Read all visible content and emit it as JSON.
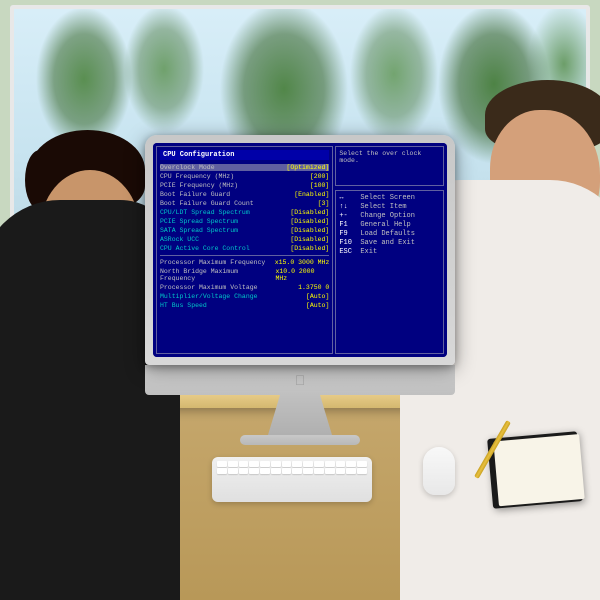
{
  "scene": {
    "alt": "Two people looking at an iMac displaying BIOS CPU Configuration screen"
  },
  "bios": {
    "title": "CPU Configuration",
    "help_title": "Select the over clock mode.",
    "rows": [
      {
        "label": "Overclock Mode",
        "value": "[Optimized]",
        "highlighted": true
      },
      {
        "label": "CPU Frequency (MHz)",
        "value": "[200]"
      },
      {
        "label": "PCIE Frequency (MHz)",
        "value": "[100]"
      },
      {
        "label": "Boot Failure Guard",
        "value": "[Enabled]"
      },
      {
        "label": "Boot Failure Guard Count",
        "value": "[3]"
      },
      {
        "label": "CPU/LDT Spread Spectrum",
        "value": "[Disabled]"
      },
      {
        "label": "PCIE Spread Spectrum",
        "value": "[Disabled]"
      },
      {
        "label": "SATA Spread Spectrum",
        "value": "[Disabled]"
      },
      {
        "label": "ASRock UCC",
        "value": "[Disabled]"
      },
      {
        "label": "CPU Active Core Control",
        "value": "[Disabled]"
      }
    ],
    "divider": true,
    "lower_rows": [
      {
        "label": "Processor Maximum Frequency",
        "value": "x15.0 3000 MHz"
      },
      {
        "label": "North Bridge Maximum Frequency",
        "value": "x10.0 2000 MHz"
      },
      {
        "label": "Processor Maximum Voltage",
        "value": "1.3750 0"
      },
      {
        "label": "Multiplier/Voltage Change",
        "value": "[Auto]"
      },
      {
        "label": "HT Bus Speed",
        "value": "[Auto]"
      }
    ],
    "help": [
      {
        "key": "↑↓",
        "desc": "Select Screen"
      },
      {
        "key": "↑↓",
        "desc": "Select Item"
      },
      {
        "key": "+-",
        "desc": "Change Option"
      },
      {
        "key": "F1",
        "desc": "General Help"
      },
      {
        "key": "F9",
        "desc": "Load Defaults"
      },
      {
        "key": "F10",
        "desc": "Save and Exit"
      },
      {
        "key": "ESC",
        "desc": "Exit"
      }
    ]
  },
  "select_text": "Select"
}
